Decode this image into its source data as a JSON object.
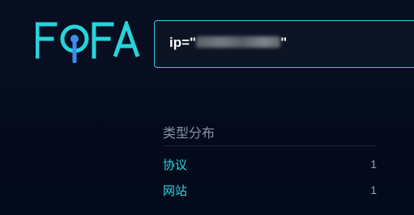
{
  "brand": {
    "logo_text": "FOFA",
    "accent_color": "#28d3dc",
    "magnifier_color": "#3a8ef0"
  },
  "search": {
    "query_prefix": "ip=\"",
    "query_suffix": "\"",
    "query_redacted": true
  },
  "stats": {
    "title": "类型分布",
    "items": [
      {
        "label": "协议",
        "count": "1"
      },
      {
        "label": "网站",
        "count": "1"
      }
    ]
  }
}
